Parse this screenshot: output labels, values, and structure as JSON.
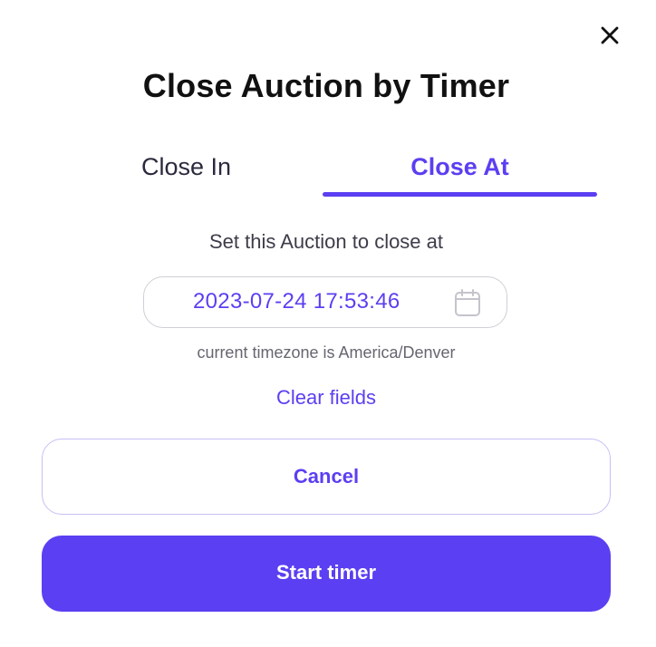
{
  "dialog": {
    "title": "Close Auction by Timer"
  },
  "tabs": [
    {
      "label": "Close In",
      "active": false
    },
    {
      "label": "Close At",
      "active": true
    }
  ],
  "form": {
    "instruction": "Set this Auction to close at",
    "datetime_value": "2023-07-24 17:53:46",
    "timezone_note": "current timezone is America/Denver",
    "clear_label": "Clear fields"
  },
  "buttons": {
    "cancel_label": "Cancel",
    "start_label": "Start timer"
  },
  "icons": {
    "close": "close-icon",
    "calendar": "calendar-icon"
  },
  "colors": {
    "accent": "#5b3ff2",
    "title": "#111111",
    "muted": "#666670"
  }
}
